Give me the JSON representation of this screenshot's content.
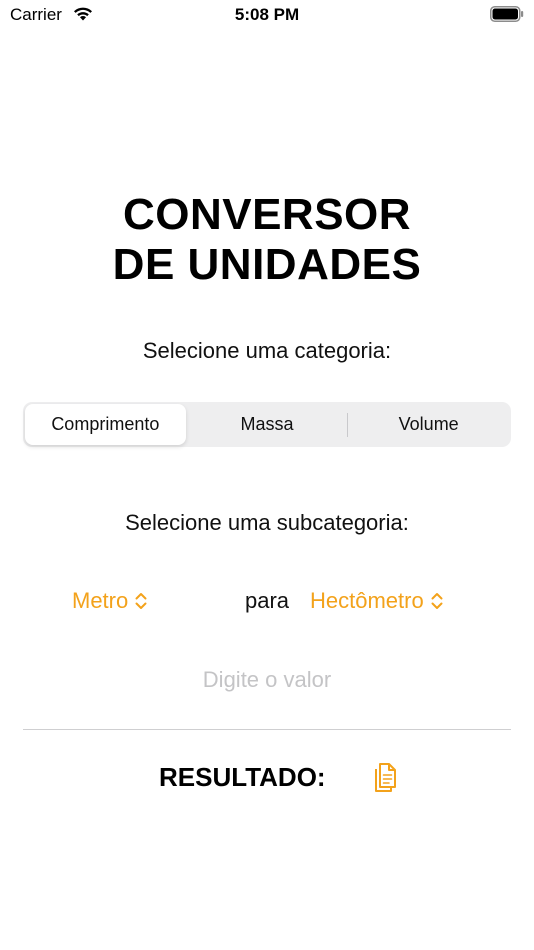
{
  "status_bar": {
    "carrier": "Carrier",
    "time": "5:08 PM"
  },
  "title": {
    "line1": "CONVERSOR",
    "line2": "DE UNIDADES"
  },
  "category_prompt": "Selecione uma categoria:",
  "categories": [
    {
      "label": "Comprimento",
      "selected": true
    },
    {
      "label": "Massa",
      "selected": false
    },
    {
      "label": "Volume",
      "selected": false
    }
  ],
  "subcategory_prompt": "Selecione uma subcategoria:",
  "conversion": {
    "from_unit": "Metro",
    "connector": "para",
    "to_unit": "Hectômetro"
  },
  "value_input": {
    "value": "",
    "placeholder": "Digite o valor"
  },
  "result": {
    "label": "RESULTADO:"
  },
  "colors": {
    "accent": "#f3a21b",
    "placeholder": "#c4c4c6"
  },
  "icons": [
    "wifi-icon",
    "battery-icon",
    "chevron-updown-icon",
    "copy-icon"
  ]
}
